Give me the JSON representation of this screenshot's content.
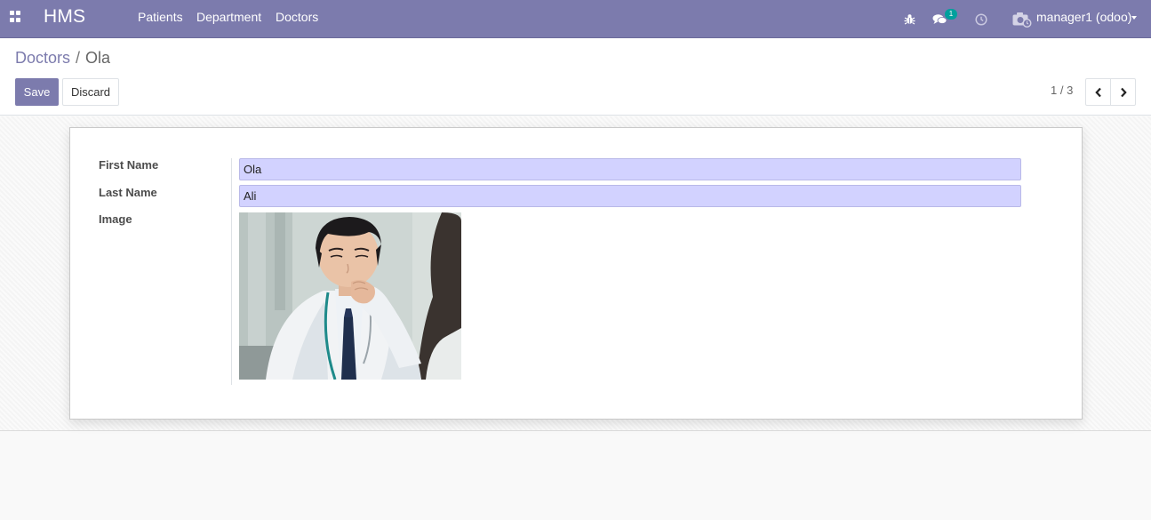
{
  "navbar": {
    "brand": "HMS",
    "menu": [
      "Patients",
      "Department",
      "Doctors"
    ],
    "chat_badge": "1",
    "user": "manager1 (odoo)",
    "icons": [
      "apps-grid-icon",
      "bug-icon",
      "chat-icon",
      "clock-icon",
      "user-avatar-icon",
      "caret-down-icon"
    ]
  },
  "breadcrumb": {
    "parent": "Doctors",
    "separator": "/",
    "current": "Ola"
  },
  "actions": {
    "save_label": "Save",
    "discard_label": "Discard"
  },
  "pager": {
    "value": "1 / 3"
  },
  "form": {
    "first_name_label": "First Name",
    "first_name_value": "Ola",
    "last_name_label": "Last Name",
    "last_name_value": "Ali",
    "image_label": "Image"
  },
  "colors": {
    "brand": "#7c7bad",
    "field_bg": "#d2d2ff",
    "badge": "#00a09d"
  }
}
